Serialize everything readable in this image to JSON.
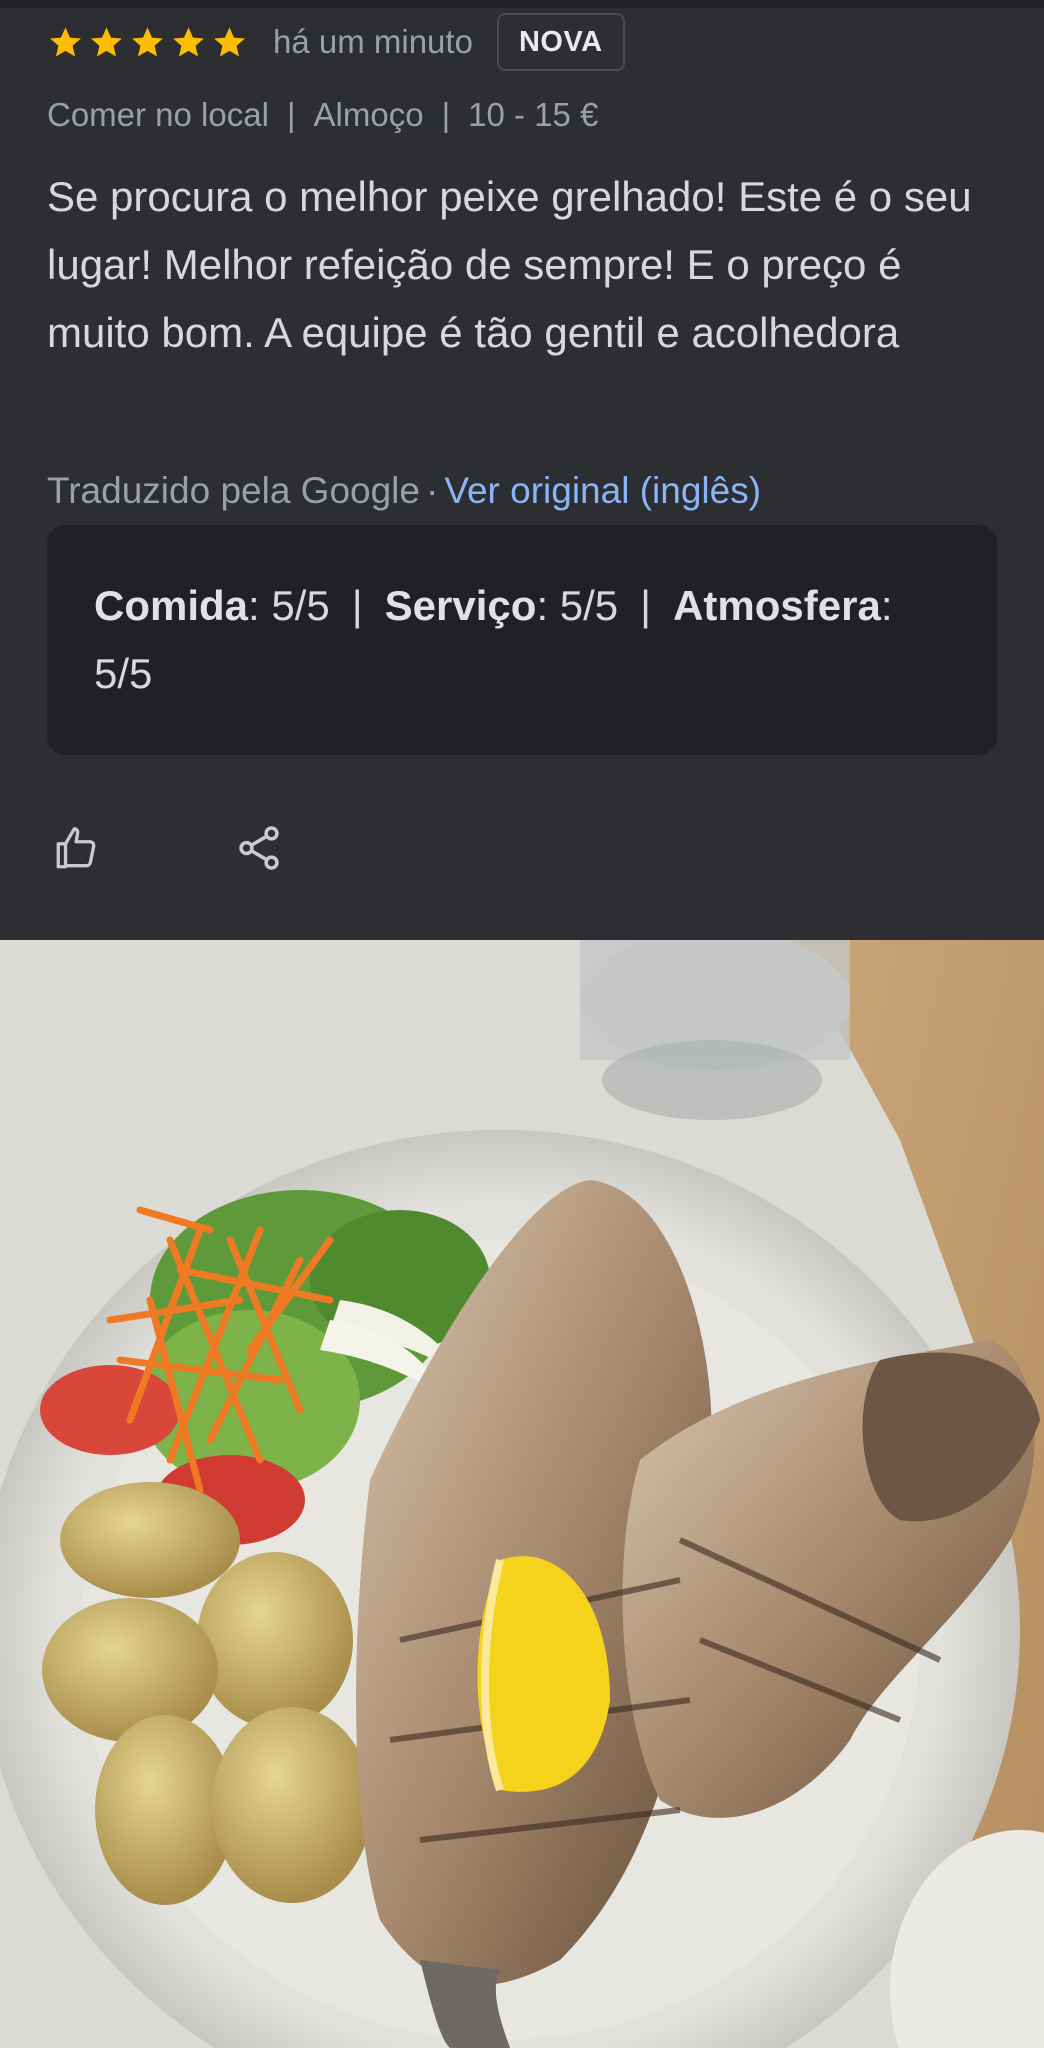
{
  "review": {
    "rating": 5,
    "rating_max": 5,
    "star_color": "#fbbc04",
    "time": "há um minuto",
    "badge": "NOVA",
    "tags": [
      "Comer no local",
      "Almoço",
      "10 - 15 €"
    ],
    "text": "Se procura o melhor peixe grelhado! Este é o seu lugar! Melhor refeição de sempre! E o preço é muito bom. A equipe é tão gentil e acolhedora",
    "translated_by": "Traduzido pela Google",
    "translated_separator": "·",
    "view_original": "Ver original (inglês)",
    "link_color": "#8ab4f8"
  },
  "ratings": {
    "food_label": "Comida",
    "food_value": "5/5",
    "service_label": "Serviço",
    "service_value": "5/5",
    "atmosphere_label": "Atmosfera",
    "atmosphere_value": "5/5"
  },
  "actions": {
    "like_icon": "thumbs-up-icon",
    "share_icon": "share-icon"
  },
  "photo": {
    "subject": "review-photo"
  }
}
